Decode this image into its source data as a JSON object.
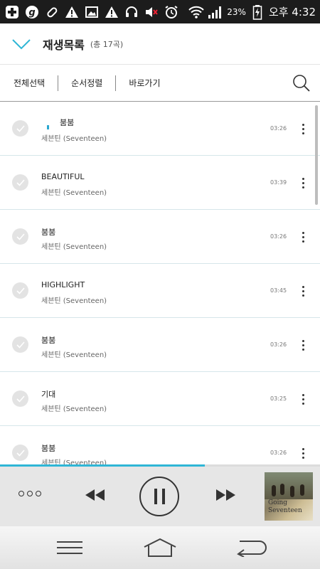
{
  "status_bar": {
    "icons": [
      "plus-icon",
      "g-icon",
      "pill-icon",
      "warning-icon",
      "image-icon",
      "warning-icon",
      "headset-icon",
      "volume-mute-icon",
      "alarm-icon",
      "wifi-icon",
      "signal-icon"
    ],
    "battery_percent": "23%",
    "time": "오후 4:32"
  },
  "header": {
    "title": "재생목록",
    "count": "(총 17곡)"
  },
  "toolbar": {
    "select_all": "전체선택",
    "sort": "순서정렬",
    "shortcut": "바로가기"
  },
  "tracks": [
    {
      "title": "붐붐",
      "artist": "세븐틴 (Seventeen)",
      "duration": "03:26"
    },
    {
      "title": "BEAUTIFUL",
      "artist": "세븐틴 (Seventeen)",
      "duration": "03:39"
    },
    {
      "title": "붐붐",
      "artist": "세븐틴 (Seventeen)",
      "duration": "03:26"
    },
    {
      "title": "HIGHLIGHT",
      "artist": "세븐틴 (Seventeen)",
      "duration": "03:45"
    },
    {
      "title": "붐붐",
      "artist": "세븐틴 (Seventeen)",
      "duration": "03:26"
    },
    {
      "title": "기대",
      "artist": "세븐틴 (Seventeen)",
      "duration": "03:25"
    },
    {
      "title": "붐붐",
      "artist": "세븐틴 (Seventeen)",
      "duration": "03:26"
    }
  ],
  "player": {
    "progress": 0.64,
    "album_title_line1": "Going",
    "album_title_line2": "Seventeen"
  },
  "colors": {
    "accent": "#2fb6d6",
    "status_bar": "#1c1c1c"
  }
}
